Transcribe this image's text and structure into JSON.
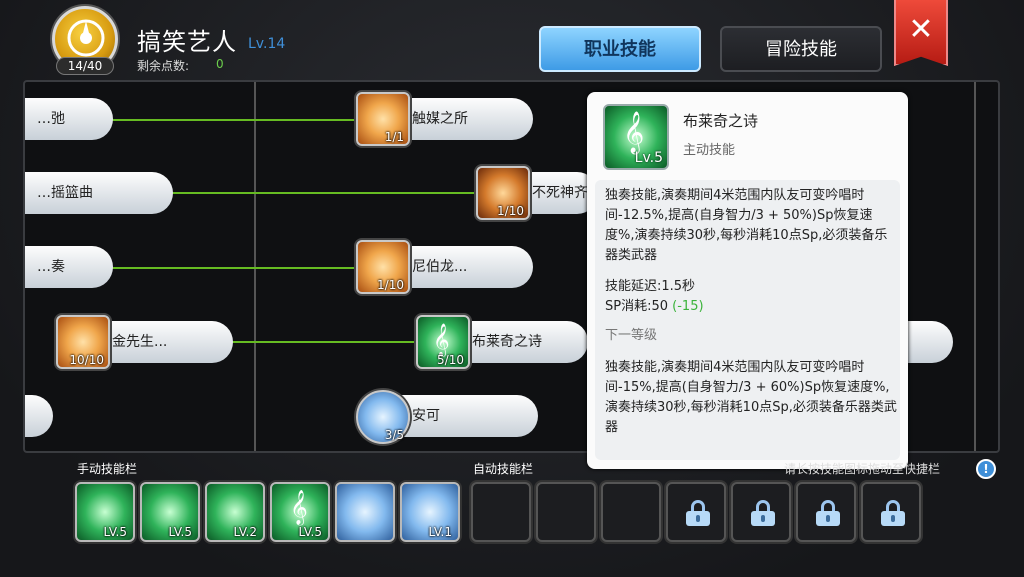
{
  "header": {
    "skill_points": "14/40",
    "job_name": "搞笑艺人",
    "job_level": "Lv.14",
    "remaining_label": "剩余点数:",
    "remaining_value": "0"
  },
  "tabs": [
    {
      "label": "职业技能",
      "active": true
    },
    {
      "label": "冒险技能",
      "active": false
    }
  ],
  "tree": {
    "pills": [
      {
        "label": "…弛"
      },
      {
        "label": "…摇篮曲"
      },
      {
        "label": "…奏"
      },
      {
        "label": "触媒之所"
      },
      {
        "label": "不死神齐"
      },
      {
        "label": "尼伯龙..."
      },
      {
        "label": "金先生..."
      },
      {
        "label": "布莱奇之诗"
      },
      {
        "label": "安可"
      }
    ],
    "skills": [
      {
        "name": "触媒之所",
        "level": "1/1",
        "icon": "flower-burst-icon"
      },
      {
        "name": "不死神齐",
        "level": "1/10",
        "icon": "sword-shield-icon"
      },
      {
        "name": "尼伯龙...",
        "level": "1/10",
        "icon": "ring-icon"
      },
      {
        "name": "金先生...",
        "level": "10/10",
        "icon": "dancer-icon"
      },
      {
        "name": "布莱奇之诗",
        "level": "5/10",
        "icon": "treble-clef-icon"
      },
      {
        "name": "安可",
        "level": "3/5",
        "icon": "encore-icon"
      }
    ]
  },
  "tooltip": {
    "name": "布莱奇之诗",
    "type": "主动技能",
    "level": "Lv.5",
    "desc": "独奏技能,演奏期间4米范围内队友可变吟唱时间-12.5%,提高(自身智力/3 + 50%)Sp恢复速度%,演奏持续30秒,每秒消耗10点Sp,必须装备乐器类武器",
    "delay": "技能延迟:1.5秒",
    "sp_label": "SP消耗:",
    "sp_value": "50",
    "sp_delta": "(-15)",
    "next_label": "下一等级",
    "next_desc": "独奏技能,演奏期间4米范围内队友可变吟唱时间-15%,提高(自身智力/3 + 60%)Sp恢复速度%,演奏持续30秒,每秒消耗10点Sp,必须装备乐器类武器"
  },
  "bottom": {
    "manual_label": "手动技能栏",
    "auto_label": "自动技能栏",
    "hint": "请长按技能图标拖动至快捷栏",
    "hint_icon": "!",
    "manual_slots": [
      {
        "level": "LV.5",
        "icon": "wing-icon"
      },
      {
        "level": "LV.5",
        "icon": "music-disc-icon"
      },
      {
        "level": "LV.2",
        "icon": "heal-note-icon"
      },
      {
        "level": "LV.5",
        "icon": "treble-clef-icon"
      },
      {
        "level": "",
        "icon": "unicorn-icon"
      },
      {
        "level": "LV.1",
        "icon": "wave-icon"
      }
    ],
    "auto_slots": [
      {
        "state": "empty"
      },
      {
        "state": "empty"
      },
      {
        "state": "empty"
      },
      {
        "state": "locked"
      },
      {
        "state": "locked"
      },
      {
        "state": "locked"
      },
      {
        "state": "locked"
      }
    ]
  },
  "colors": {
    "accent": "#3e9be6",
    "progress_green": "#66bb22",
    "close_red": "#d12a1e"
  }
}
